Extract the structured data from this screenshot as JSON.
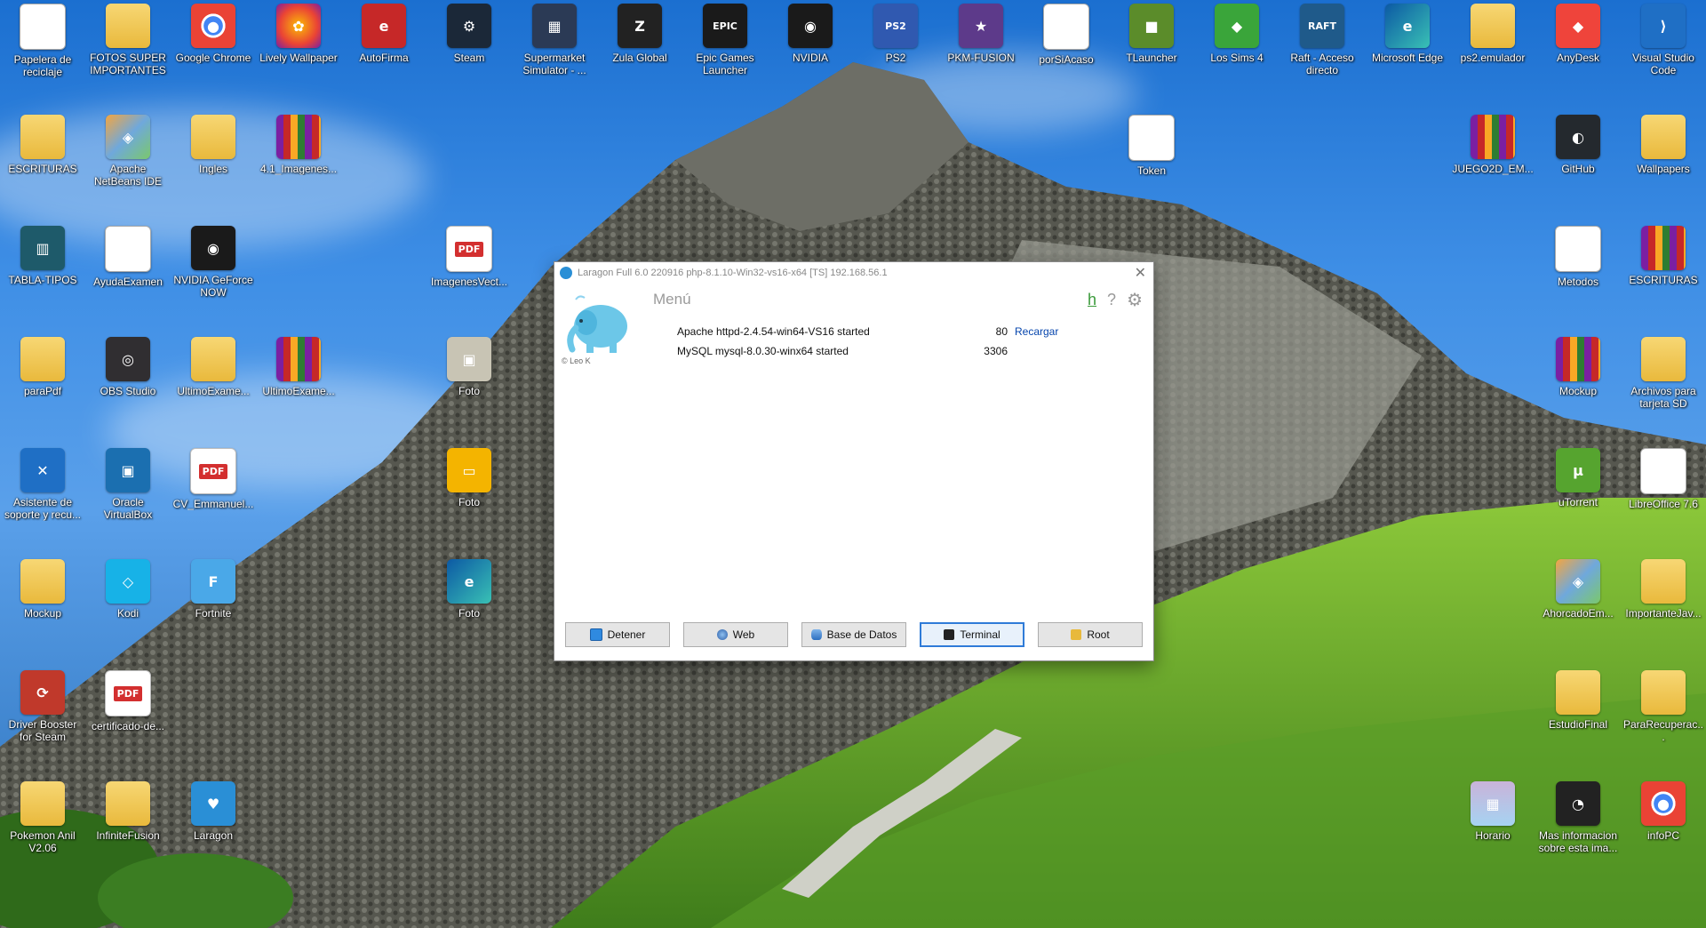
{
  "desktop": {
    "icons": [
      {
        "label": "Papelera de reciclaje",
        "icon": "recycle-bin-icon",
        "glyph": "♻",
        "style": "g-doc"
      },
      {
        "label": "FOTOS SUPER IMPORTANTES",
        "icon": "folder-icon",
        "glyph": "",
        "style": "g-folder"
      },
      {
        "label": "Google Chrome",
        "icon": "chrome-icon",
        "glyph": "●",
        "style": "chrome"
      },
      {
        "label": "Lively Wallpaper",
        "icon": "lively-icon",
        "glyph": "✿",
        "style": "lively"
      },
      {
        "label": "AutoFirma",
        "icon": "autofirma-icon",
        "glyph": "e",
        "style": "autofirma"
      },
      {
        "label": "Steam",
        "icon": "steam-icon",
        "glyph": "⚙",
        "style": "steam"
      },
      {
        "label": "Supermarket Simulator - ...",
        "icon": "game-icon",
        "glyph": "▦",
        "style": "super"
      },
      {
        "label": "Zula Global",
        "icon": "zula-icon",
        "glyph": "Z",
        "style": "zula"
      },
      {
        "label": "Epic Games Launcher",
        "icon": "epic-icon",
        "glyph": "EPIC",
        "style": "epic"
      },
      {
        "label": "NVIDIA",
        "icon": "nvidia-icon",
        "glyph": "◉",
        "style": "nvidia"
      },
      {
        "label": "PS2",
        "icon": "ps2-icon",
        "glyph": "PS2",
        "style": "ps2"
      },
      {
        "label": "PKM-FUSION",
        "icon": "pokemon-icon",
        "glyph": "★",
        "style": "pkm"
      },
      {
        "label": "porSiAcaso",
        "icon": "document-icon",
        "glyph": "",
        "style": "g-doc"
      },
      {
        "label": "TLauncher",
        "icon": "minecraft-icon",
        "glyph": "■",
        "style": "tl"
      },
      {
        "label": "Los Sims 4",
        "icon": "sims-icon",
        "glyph": "◆",
        "style": "sims"
      },
      {
        "label": "Raft - Acceso directo",
        "icon": "raft-icon",
        "glyph": "RAFT",
        "style": "raft"
      },
      {
        "label": "Microsoft Edge",
        "icon": "edge-icon",
        "glyph": "e",
        "style": "edge"
      },
      {
        "label": "ps2.emulador",
        "icon": "folder-icon",
        "glyph": "",
        "style": "g-folder"
      },
      {
        "label": "AnyDesk",
        "icon": "anydesk-icon",
        "glyph": "◆",
        "style": "anydesk"
      },
      {
        "label": "Visual Studio Code",
        "icon": "vscode-icon",
        "glyph": "⟩",
        "style": "vscode"
      },
      {
        "label": "ESCRITURAS",
        "icon": "folder-icon",
        "glyph": "",
        "style": "g-folder"
      },
      {
        "label": "Apache NetBeans IDE 19",
        "icon": "netbeans-icon",
        "glyph": "◈",
        "style": "netbeans"
      },
      {
        "label": "Ingles",
        "icon": "folder-icon",
        "glyph": "",
        "style": "g-folder"
      },
      {
        "label": "4.1_Imagenes...",
        "icon": "winrar-icon",
        "glyph": "",
        "style": "g-rar"
      },
      {
        "label": "Token",
        "icon": "document-icon",
        "glyph": "",
        "style": "g-doc"
      },
      {
        "label": "JUEGO2D_EM...",
        "icon": "winrar-icon",
        "glyph": "",
        "style": "g-rar"
      },
      {
        "label": "GitHub",
        "icon": "github-icon",
        "glyph": "◐",
        "style": "github"
      },
      {
        "label": "Wallpapers",
        "icon": "folder-icon",
        "glyph": "",
        "style": "g-folder"
      },
      {
        "label": "TABLA-TIPOS",
        "icon": "file-icon",
        "glyph": "▥",
        "style": "tabla"
      },
      {
        "label": "AyudaExamen",
        "icon": "document-icon",
        "glyph": "",
        "style": "g-doc"
      },
      {
        "label": "NVIDIA GeForce NOW",
        "icon": "nvidia-icon",
        "glyph": "◉",
        "style": "nvidia"
      },
      {
        "label": "ImagenesVect...",
        "icon": "pdf-icon",
        "glyph": "PDF",
        "style": "g-pdf"
      },
      {
        "label": "Metodos",
        "icon": "document-icon",
        "glyph": "",
        "style": "g-doc"
      },
      {
        "label": "ESCRITURAS",
        "icon": "winrar-icon",
        "glyph": "",
        "style": "g-rar"
      },
      {
        "label": "paraPdf",
        "icon": "folder-icon",
        "glyph": "",
        "style": "g-folder"
      },
      {
        "label": "OBS Studio",
        "icon": "obs-icon",
        "glyph": "◎",
        "style": "obs"
      },
      {
        "label": "UltimoExame...",
        "icon": "folder-icon",
        "glyph": "",
        "style": "g-folder"
      },
      {
        "label": "UltimoExame...",
        "icon": "winrar-icon",
        "glyph": "",
        "style": "g-rar"
      },
      {
        "label": "Foto",
        "icon": "image-icon",
        "glyph": "▣",
        "style": "foto"
      },
      {
        "label": "Mockup",
        "icon": "winrar-icon",
        "glyph": "",
        "style": "g-rar"
      },
      {
        "label": "Archivos para tarjeta SD",
        "icon": "folder-icon",
        "glyph": "",
        "style": "g-folder"
      },
      {
        "label": "Asistente de soporte y recu...",
        "icon": "tools-icon",
        "glyph": "✕",
        "style": "asist"
      },
      {
        "label": "Oracle VirtualBox",
        "icon": "virtualbox-icon",
        "glyph": "▣",
        "style": "vbox"
      },
      {
        "label": "CV_Emmanuel...",
        "icon": "pdf-icon",
        "glyph": "PDF",
        "style": "g-pdf"
      },
      {
        "label": "Foto",
        "icon": "slides-icon",
        "glyph": "▭",
        "style": "slides"
      },
      {
        "label": "uTorrent",
        "icon": "utorrent-icon",
        "glyph": "µ",
        "style": "utorrent"
      },
      {
        "label": "LibreOffice 7.6",
        "icon": "libreoffice-icon",
        "glyph": "",
        "style": "g-doc"
      },
      {
        "label": "Mockup",
        "icon": "folder-icon",
        "glyph": "",
        "style": "g-folder"
      },
      {
        "label": "Kodi",
        "icon": "kodi-icon",
        "glyph": "◇",
        "style": "kodi"
      },
      {
        "label": "Fortnite",
        "icon": "fortnite-icon",
        "glyph": "F",
        "style": "fortnite"
      },
      {
        "label": "Foto",
        "icon": "edge-icon",
        "glyph": "e",
        "style": "edge"
      },
      {
        "label": "AhorcadoEm...",
        "icon": "netbeans-icon",
        "glyph": "◈",
        "style": "netbeans"
      },
      {
        "label": "ImportanteJav...",
        "icon": "folder-icon",
        "glyph": "",
        "style": "g-folder"
      },
      {
        "label": "Driver Booster for Steam",
        "icon": "driverbooster-icon",
        "glyph": "⟳",
        "style": "driver"
      },
      {
        "label": "certificado-de...",
        "icon": "pdf-icon",
        "glyph": "PDF",
        "style": "g-pdf"
      },
      {
        "label": "EstudioFinal",
        "icon": "folder-icon",
        "glyph": "",
        "style": "g-folder"
      },
      {
        "label": "ParaRecuperac...",
        "icon": "folder-icon",
        "glyph": "",
        "style": "g-folder"
      },
      {
        "label": "Pokemon Anil V2.06",
        "icon": "folder-icon",
        "glyph": "",
        "style": "g-folder"
      },
      {
        "label": "InfiniteFusion",
        "icon": "folder-icon",
        "glyph": "",
        "style": "g-folder"
      },
      {
        "label": "Laragon",
        "icon": "laragon-icon",
        "glyph": "♥",
        "style": "laragon"
      },
      {
        "label": "Horario",
        "icon": "image-icon",
        "glyph": "▦",
        "style": "horario"
      },
      {
        "label": "Mas informacion sobre esta ima...",
        "icon": "info-icon",
        "glyph": "◔",
        "style": "info"
      },
      {
        "label": "infoPC",
        "icon": "chrome-icon",
        "glyph": "●",
        "style": "chrome"
      }
    ]
  },
  "laragon": {
    "title": "Laragon Full 6.0 220916 php-8.1.10-Win32-vs16-x64 [TS]  192.168.56.1",
    "menu": "Menú",
    "credit": "© Leo K",
    "help_h": "h",
    "help_q": "?",
    "services": [
      {
        "name": "Apache httpd-2.4.54-win64-VS16 started",
        "port": "80",
        "action": "Recargar"
      },
      {
        "name": "MySQL mysql-8.0.30-winx64 started",
        "port": "3306",
        "action": ""
      }
    ],
    "buttons": [
      {
        "label": "Detener",
        "icon": "stop-icon",
        "color": "#2f8ae0"
      },
      {
        "label": "Web",
        "icon": "globe-icon",
        "color": "#3b6fb6"
      },
      {
        "label": "Base de Datos",
        "icon": "database-icon",
        "color": "#3d7fd0"
      },
      {
        "label": "Terminal",
        "icon": "terminal-icon",
        "color": "#222222"
      },
      {
        "label": "Root",
        "icon": "folder-icon",
        "color": "#e8b93c"
      }
    ]
  }
}
